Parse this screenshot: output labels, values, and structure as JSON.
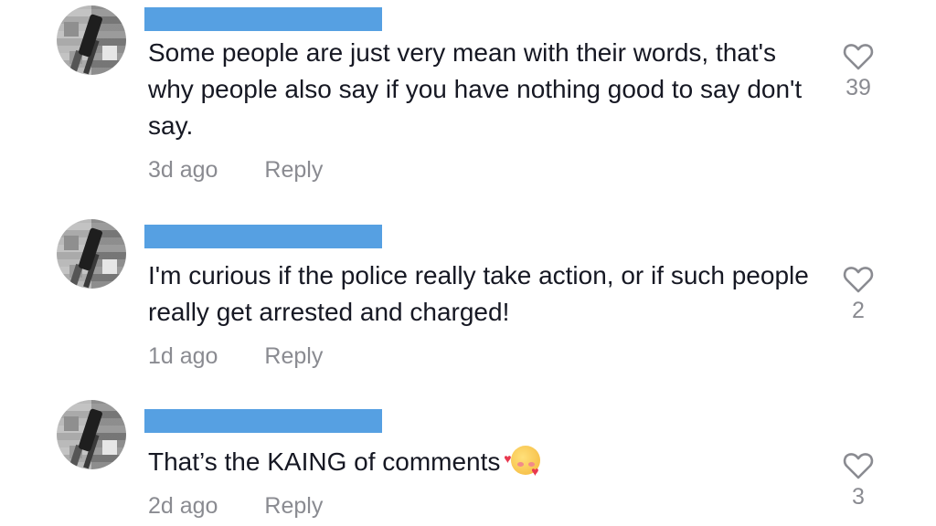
{
  "comments": [
    {
      "text": "Some people are just very mean with their words, that's why people also say if you have nothing good to say don't say.",
      "time": "3d ago",
      "reply_label": "Reply",
      "likes": "39"
    },
    {
      "text": "I'm curious if the police really take action, or if such people really get arrested and charged!",
      "time": "1d ago",
      "reply_label": "Reply",
      "likes": "2"
    },
    {
      "text": "That’s the KAING of comments",
      "emoji": "smiling-face-with-hearts",
      "time": "2d ago",
      "reply_label": "Reply",
      "likes": "3"
    }
  ],
  "colors": {
    "username_redaction": "#56a0e2",
    "meta_text": "#8a8b91",
    "body_text": "#161823"
  }
}
